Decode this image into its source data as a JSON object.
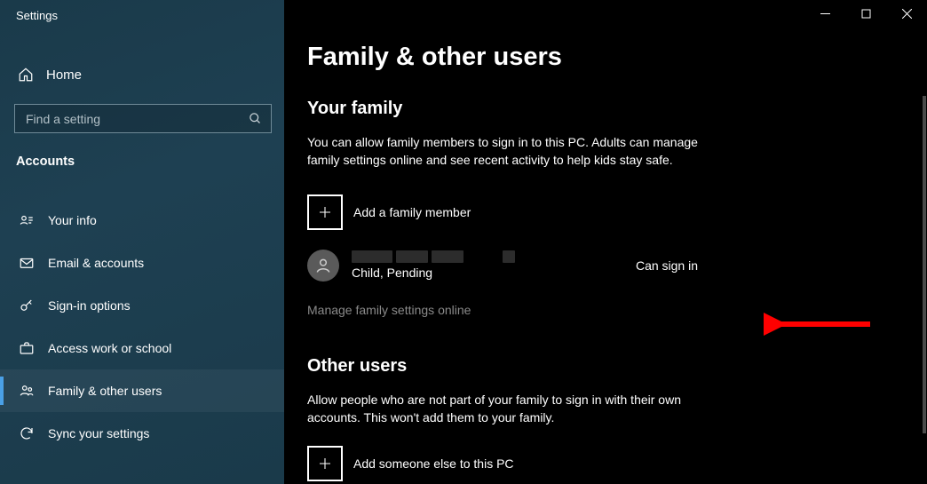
{
  "window": {
    "title": "Settings"
  },
  "sidebar": {
    "home": "Home",
    "search_placeholder": "Find a setting",
    "section": "Accounts",
    "items": [
      {
        "label": "Your info"
      },
      {
        "label": "Email & accounts"
      },
      {
        "label": "Sign-in options"
      },
      {
        "label": "Access work or school"
      },
      {
        "label": "Family & other users"
      },
      {
        "label": "Sync your settings"
      }
    ]
  },
  "main": {
    "title": "Family & other users",
    "family": {
      "heading": "Your family",
      "description": "You can allow family members to sign in to this PC. Adults can manage family settings online and see recent activity to help kids stay safe.",
      "add_label": "Add a family member",
      "member": {
        "status_line": "Child, Pending",
        "signin_status": "Can sign in"
      },
      "manage_link": "Manage family settings online"
    },
    "other": {
      "heading": "Other users",
      "description": "Allow people who are not part of your family to sign in with their own accounts. This won't add them to your family.",
      "add_label": "Add someone else to this PC"
    }
  }
}
